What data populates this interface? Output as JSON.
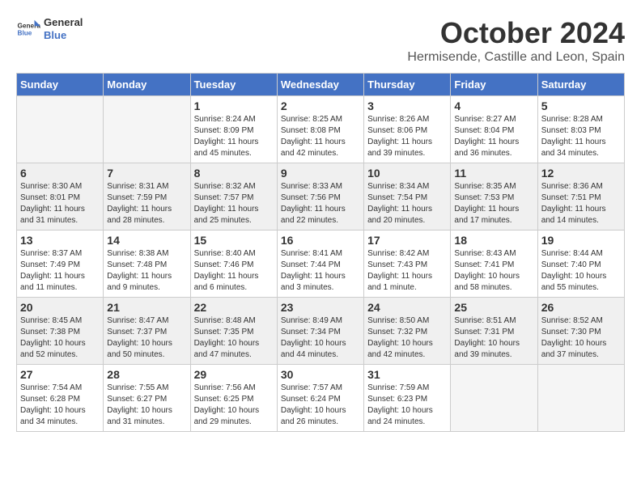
{
  "header": {
    "logo_general": "General",
    "logo_blue": "Blue",
    "month_title": "October 2024",
    "subtitle": "Hermisende, Castille and Leon, Spain"
  },
  "weekdays": [
    "Sunday",
    "Monday",
    "Tuesday",
    "Wednesday",
    "Thursday",
    "Friday",
    "Saturday"
  ],
  "weeks": [
    [
      {
        "day": "",
        "info": ""
      },
      {
        "day": "",
        "info": ""
      },
      {
        "day": "1",
        "info": "Sunrise: 8:24 AM\nSunset: 8:09 PM\nDaylight: 11 hours and 45 minutes."
      },
      {
        "day": "2",
        "info": "Sunrise: 8:25 AM\nSunset: 8:08 PM\nDaylight: 11 hours and 42 minutes."
      },
      {
        "day": "3",
        "info": "Sunrise: 8:26 AM\nSunset: 8:06 PM\nDaylight: 11 hours and 39 minutes."
      },
      {
        "day": "4",
        "info": "Sunrise: 8:27 AM\nSunset: 8:04 PM\nDaylight: 11 hours and 36 minutes."
      },
      {
        "day": "5",
        "info": "Sunrise: 8:28 AM\nSunset: 8:03 PM\nDaylight: 11 hours and 34 minutes."
      }
    ],
    [
      {
        "day": "6",
        "info": "Sunrise: 8:30 AM\nSunset: 8:01 PM\nDaylight: 11 hours and 31 minutes."
      },
      {
        "day": "7",
        "info": "Sunrise: 8:31 AM\nSunset: 7:59 PM\nDaylight: 11 hours and 28 minutes."
      },
      {
        "day": "8",
        "info": "Sunrise: 8:32 AM\nSunset: 7:57 PM\nDaylight: 11 hours and 25 minutes."
      },
      {
        "day": "9",
        "info": "Sunrise: 8:33 AM\nSunset: 7:56 PM\nDaylight: 11 hours and 22 minutes."
      },
      {
        "day": "10",
        "info": "Sunrise: 8:34 AM\nSunset: 7:54 PM\nDaylight: 11 hours and 20 minutes."
      },
      {
        "day": "11",
        "info": "Sunrise: 8:35 AM\nSunset: 7:53 PM\nDaylight: 11 hours and 17 minutes."
      },
      {
        "day": "12",
        "info": "Sunrise: 8:36 AM\nSunset: 7:51 PM\nDaylight: 11 hours and 14 minutes."
      }
    ],
    [
      {
        "day": "13",
        "info": "Sunrise: 8:37 AM\nSunset: 7:49 PM\nDaylight: 11 hours and 11 minutes."
      },
      {
        "day": "14",
        "info": "Sunrise: 8:38 AM\nSunset: 7:48 PM\nDaylight: 11 hours and 9 minutes."
      },
      {
        "day": "15",
        "info": "Sunrise: 8:40 AM\nSunset: 7:46 PM\nDaylight: 11 hours and 6 minutes."
      },
      {
        "day": "16",
        "info": "Sunrise: 8:41 AM\nSunset: 7:44 PM\nDaylight: 11 hours and 3 minutes."
      },
      {
        "day": "17",
        "info": "Sunrise: 8:42 AM\nSunset: 7:43 PM\nDaylight: 11 hours and 1 minute."
      },
      {
        "day": "18",
        "info": "Sunrise: 8:43 AM\nSunset: 7:41 PM\nDaylight: 10 hours and 58 minutes."
      },
      {
        "day": "19",
        "info": "Sunrise: 8:44 AM\nSunset: 7:40 PM\nDaylight: 10 hours and 55 minutes."
      }
    ],
    [
      {
        "day": "20",
        "info": "Sunrise: 8:45 AM\nSunset: 7:38 PM\nDaylight: 10 hours and 52 minutes."
      },
      {
        "day": "21",
        "info": "Sunrise: 8:47 AM\nSunset: 7:37 PM\nDaylight: 10 hours and 50 minutes."
      },
      {
        "day": "22",
        "info": "Sunrise: 8:48 AM\nSunset: 7:35 PM\nDaylight: 10 hours and 47 minutes."
      },
      {
        "day": "23",
        "info": "Sunrise: 8:49 AM\nSunset: 7:34 PM\nDaylight: 10 hours and 44 minutes."
      },
      {
        "day": "24",
        "info": "Sunrise: 8:50 AM\nSunset: 7:32 PM\nDaylight: 10 hours and 42 minutes."
      },
      {
        "day": "25",
        "info": "Sunrise: 8:51 AM\nSunset: 7:31 PM\nDaylight: 10 hours and 39 minutes."
      },
      {
        "day": "26",
        "info": "Sunrise: 8:52 AM\nSunset: 7:30 PM\nDaylight: 10 hours and 37 minutes."
      }
    ],
    [
      {
        "day": "27",
        "info": "Sunrise: 7:54 AM\nSunset: 6:28 PM\nDaylight: 10 hours and 34 minutes."
      },
      {
        "day": "28",
        "info": "Sunrise: 7:55 AM\nSunset: 6:27 PM\nDaylight: 10 hours and 31 minutes."
      },
      {
        "day": "29",
        "info": "Sunrise: 7:56 AM\nSunset: 6:25 PM\nDaylight: 10 hours and 29 minutes."
      },
      {
        "day": "30",
        "info": "Sunrise: 7:57 AM\nSunset: 6:24 PM\nDaylight: 10 hours and 26 minutes."
      },
      {
        "day": "31",
        "info": "Sunrise: 7:59 AM\nSunset: 6:23 PM\nDaylight: 10 hours and 24 minutes."
      },
      {
        "day": "",
        "info": ""
      },
      {
        "day": "",
        "info": ""
      }
    ]
  ]
}
